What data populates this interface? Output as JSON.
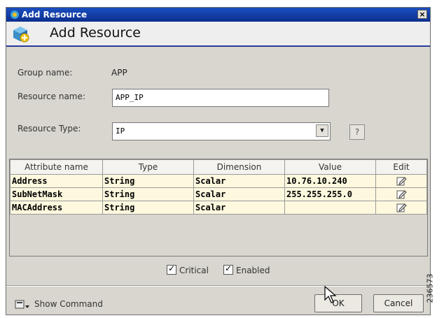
{
  "window": {
    "title": "Add Resource",
    "close_label": "×"
  },
  "header": {
    "title": "Add Resource"
  },
  "form": {
    "group_name_label": "Group name:",
    "group_name_value": "APP",
    "resource_name_label": "Resource name:",
    "resource_name_value": "APP_IP",
    "resource_type_label": "Resource Type:",
    "resource_type_value": "IP",
    "help_label": "?"
  },
  "attributes": {
    "columns": [
      "Attribute name",
      "Type",
      "Dimension",
      "Value",
      "Edit"
    ],
    "rows": [
      {
        "name": "Address",
        "type": "String",
        "dimension": "Scalar",
        "value": "10.76.10.240"
      },
      {
        "name": "SubNetMask",
        "type": "String",
        "dimension": "Scalar",
        "value": "255.255.255.0"
      },
      {
        "name": "MACAddress",
        "type": "String",
        "dimension": "Scalar",
        "value": ""
      }
    ]
  },
  "options": {
    "critical_label": "Critical",
    "enabled_label": "Enabled",
    "critical_checked": true,
    "enabled_checked": true
  },
  "footer": {
    "show_command_label": "Show Command",
    "ok_label": "OK",
    "cancel_label": "Cancel"
  },
  "figure_id": "236573",
  "colors": {
    "title_bar": "#1a4fbf",
    "row_fill": "#fdf8de",
    "dialog_bg": "#d8d6ce"
  }
}
